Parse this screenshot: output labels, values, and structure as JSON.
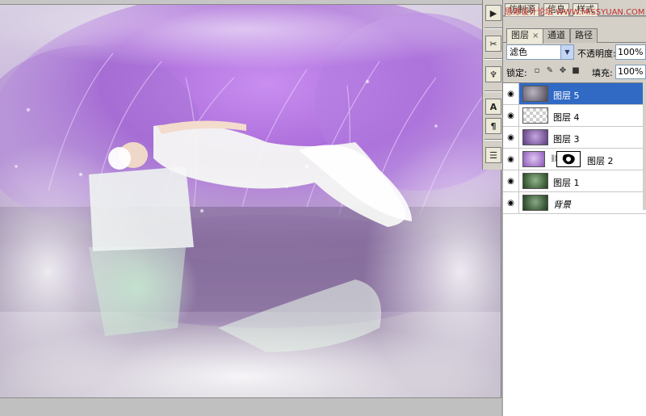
{
  "watermark": "思缘设计论坛 WWW.MISSYUAN.COM",
  "top_tabs": [
    "仿制源",
    "信息",
    "样式"
  ],
  "tool_strip": [
    {
      "icon": "play-icon",
      "glyph": "▶"
    },
    {
      "icon": "brush-tools-icon",
      "glyph": "✂"
    },
    {
      "icon": "clone-stamp-icon",
      "glyph": "♆"
    },
    {
      "icon": "character-icon",
      "glyph": "A"
    },
    {
      "icon": "paragraph-icon",
      "glyph": "¶"
    },
    {
      "icon": "layer-comps-icon",
      "glyph": "☰"
    }
  ],
  "panel": {
    "tabs": [
      {
        "label": "图层",
        "active": true,
        "close": "×"
      },
      {
        "label": "通道",
        "active": false
      },
      {
        "label": "路径",
        "active": false
      }
    ],
    "blend_mode": "滤色",
    "blend_arrow": "▼",
    "opacity_label": "不透明度:",
    "opacity_value": "100%",
    "lock_label": "锁定:",
    "lock_icons": [
      {
        "icon": "lock-transparent-icon",
        "glyph": "▫"
      },
      {
        "icon": "lock-paint-icon",
        "glyph": "✎"
      },
      {
        "icon": "lock-move-icon",
        "glyph": "✥"
      },
      {
        "icon": "lock-all-icon",
        "glyph": "■"
      }
    ],
    "fill_label": "填充:",
    "fill_value": "100%"
  },
  "layers": [
    {
      "name": "图层 5",
      "selected": true,
      "thumb": "#6a6674"
    },
    {
      "name": "图层 4",
      "selected": false,
      "thumb": "checker"
    },
    {
      "name": "图层 3",
      "selected": false,
      "thumb": "#7a4aa0"
    },
    {
      "name": "图层 2",
      "selected": false,
      "thumb": "#9b6cc4",
      "mask": true
    },
    {
      "name": "图层 1",
      "selected": false,
      "thumb": "#3f6a3a"
    },
    {
      "name": "背景",
      "selected": false,
      "thumb": "#355a33",
      "italic": true
    }
  ],
  "eye_glyph": "◉",
  "link_glyph": "⛓",
  "colors": {
    "selection": "#316ac5",
    "panel_bg": "#d4d0c8",
    "purple_foliage": "#b67be0"
  }
}
